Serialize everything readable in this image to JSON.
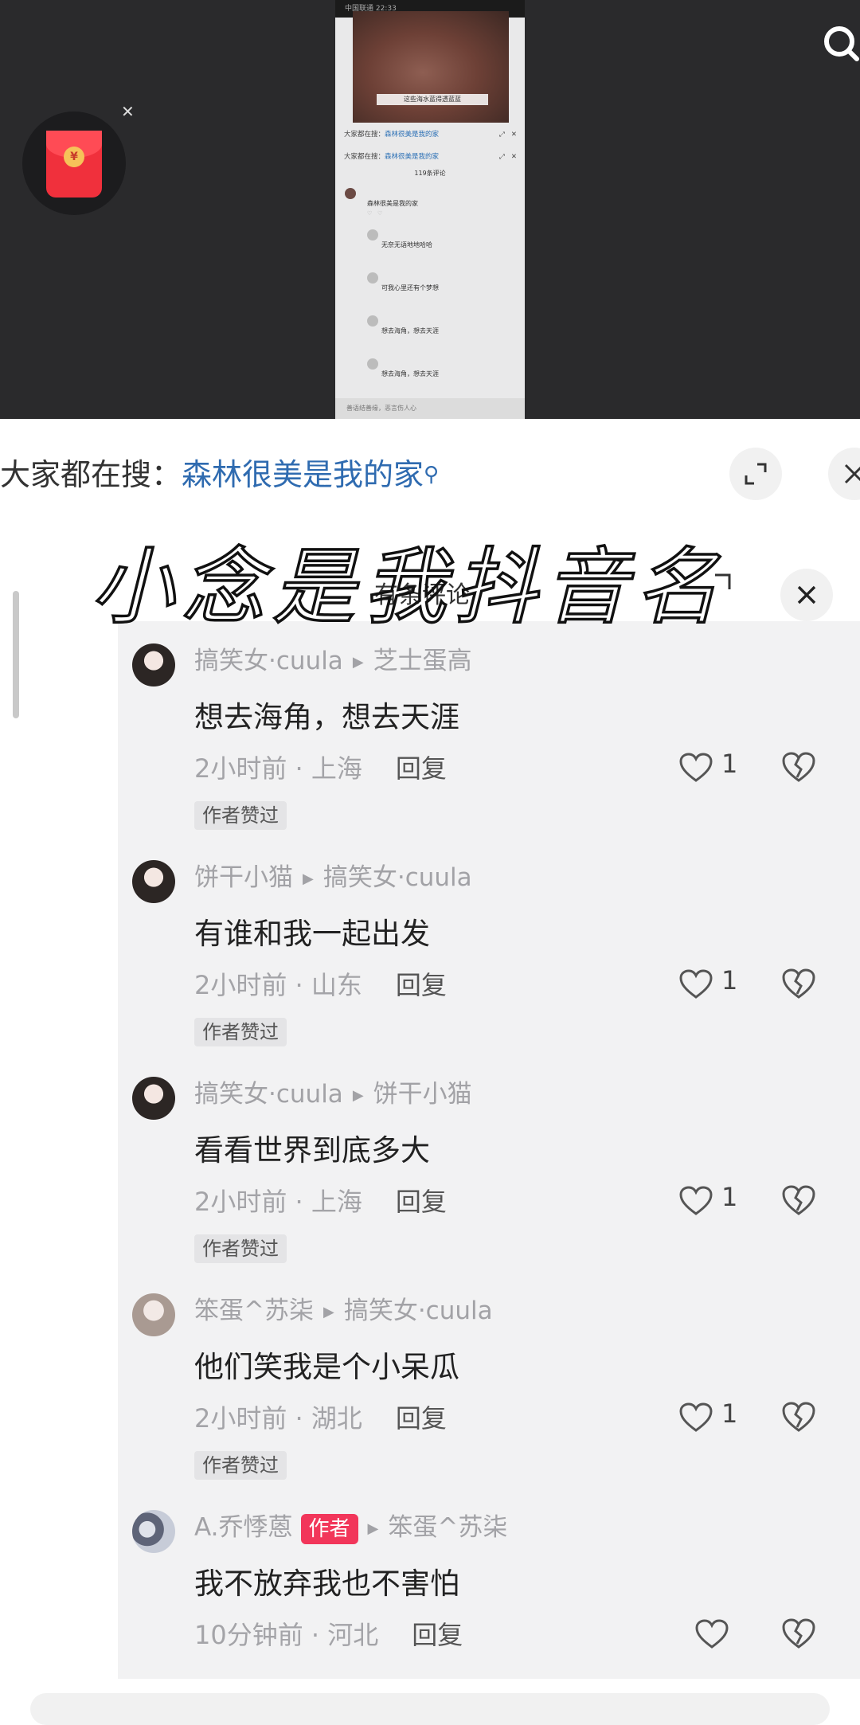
{
  "thumbnail": {
    "video_caption": "这些海水蓝得透蓝蓝",
    "rows": [
      {
        "label": "大家都在搜：",
        "keyword": "森林很美是我的家"
      },
      {
        "label": "大家都在搜：",
        "keyword": "森林很美是我的家"
      }
    ],
    "count": "119条评论",
    "mini_comments": [
      "森林很美是我的家",
      "无奈无语地地哈哈",
      "可我心里还有个梦想",
      "想去海角，想去天涯",
      "想去海角，想去天涯"
    ],
    "footer_placeholder": "善语结善缘，恶言伤人心"
  },
  "search": {
    "label": "大家都在搜：",
    "keyword": "森林很美是我的家"
  },
  "overlay": {
    "handwritten": "小念是我抖音名",
    "panel_title": "有条评论"
  },
  "comments": [
    {
      "user": "搞笑女·cuula",
      "reply_to": "芝士蛋高",
      "text": "想去海角，想去天涯",
      "time": "2小时前",
      "location": "上海",
      "reply_label": "回复",
      "likes": "1",
      "badge": "作者赞过"
    },
    {
      "user": "饼干小猫",
      "reply_to": "搞笑女·cuula",
      "text": "有谁和我一起出发",
      "time": "2小时前",
      "location": "山东",
      "reply_label": "回复",
      "likes": "1",
      "badge": "作者赞过"
    },
    {
      "user": "搞笑女·cuula",
      "reply_to": "饼干小猫",
      "text": "看看世界到底多大",
      "time": "2小时前",
      "location": "上海",
      "reply_label": "回复",
      "likes": "1",
      "badge": "作者赞过"
    },
    {
      "user": "笨蛋^苏柒",
      "reply_to": "搞笑女·cuula",
      "text": "他们笑我是个小呆瓜",
      "time": "2小时前",
      "location": "湖北",
      "reply_label": "回复",
      "likes": "1",
      "badge": "作者赞过"
    },
    {
      "user": "A.乔悸蒽",
      "author_tag": "作者",
      "reply_to": "笨蛋^苏柒",
      "text": "我不放弃我也不害怕",
      "time": "10分钟前",
      "location": "河北",
      "reply_label": "回复",
      "likes": "",
      "badge": ""
    }
  ],
  "icons": {
    "red_packet": "red-packet-icon",
    "search": "search-icon",
    "expand": "expand-icon",
    "close": "close-icon",
    "like": "heart-icon",
    "dislike": "broken-heart-icon"
  }
}
